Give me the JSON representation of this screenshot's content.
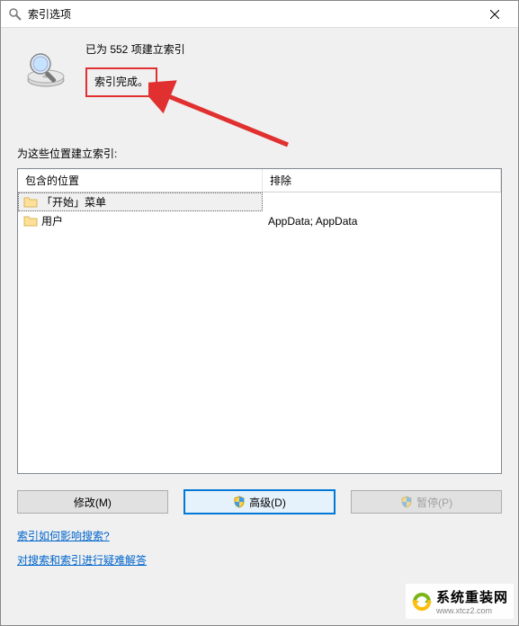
{
  "titlebar": {
    "title": "索引选项"
  },
  "status": {
    "count_line": "已为 552 项建立索引",
    "complete_line": "索引完成。"
  },
  "section": {
    "locations_label": "为这些位置建立索引:"
  },
  "table": {
    "headers": {
      "include": "包含的位置",
      "exclude": "排除"
    },
    "rows": [
      {
        "include": "「开始」菜单",
        "exclude": ""
      },
      {
        "include": "用户",
        "exclude": "AppData; AppData"
      }
    ]
  },
  "buttons": {
    "modify": "修改(M)",
    "advanced": "高级(D)",
    "pause": "暂停(P)"
  },
  "links": {
    "impact": "索引如何影响搜索?",
    "troubleshoot": "对搜索和索引进行疑难解答"
  },
  "watermark": {
    "main": "系统重装网",
    "sub": "www.xtcz2.com"
  }
}
